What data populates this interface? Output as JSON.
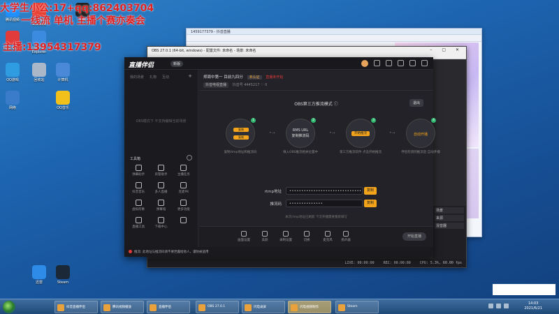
{
  "overlay": {
    "line1": "大学生小公:17+qq:862403704",
    "line2": "一线流 单机 主播个赛亦奏会",
    "line3": "主播:13954317379"
  },
  "desktop_icons": [
    {
      "label": "腾讯视频",
      "color": "#1f8fff"
    },
    {
      "label": "Google Chrome",
      "color": "#e94235"
    },
    {
      "label": "WPS Office",
      "color": "#e23b3b"
    },
    {
      "label": "QQ游戏",
      "color": "#2f9be0"
    },
    {
      "label": "回收站",
      "color": "#aab7c9"
    },
    {
      "label": "计算机",
      "color": "#4a89d8"
    },
    {
      "label": "Internet Explorer",
      "color": "#3b8be0"
    },
    {
      "label": "剪映",
      "color": "#222"
    },
    {
      "label": "网络",
      "color": "#3a7cc9"
    },
    {
      "label": "QQ音乐",
      "color": "#f2c01b"
    },
    {
      "label": "Steam",
      "color": "#1b2838"
    },
    {
      "label": "迅雷",
      "color": "#2e8ce8"
    }
  ],
  "browser": {
    "title": "1459177379 - 抖音直播"
  },
  "obs": {
    "title": "OBS 27.0.1 (64-bit, windows) - 配置文件: 未命名 - 场景: 未命名",
    "side_items": [
      "场景",
      "来源",
      "混音器"
    ],
    "status": {
      "live": "LIVE: 00:00:00",
      "rec": "REC: 00:00:00",
      "cpu": "CPU: 5.3%, 60.00 fps"
    }
  },
  "app": {
    "logo": "直播伴侣",
    "badge": "新版",
    "left_tabs": [
      "我的场景",
      "礼物",
      "互动"
    ],
    "left_empty": "OBS模式下 不支持编辑当前场景",
    "tools_title": "工具箱",
    "tools": [
      "弹幕助手",
      "房管助手",
      "主播任务",
      "抖音音乐",
      "多人直播",
      "连麦PK",
      "虚拟形象",
      "弹幕墙",
      "更多功能",
      "直播工具",
      "下载中心",
      ""
    ],
    "room": {
      "title": "郑周中第一 目前九四分",
      "tag": "未认证",
      "live_state": "直播未开始",
      "room_pill": "抖音电视直播",
      "number": "抖音号 4445217",
      "likes": "0"
    },
    "mode_title": "OBS第三方推流模式",
    "exit_label": "退出",
    "steps": [
      {
        "num": "1",
        "btn1": "复制",
        "btn2": "复制",
        "desc": "复制rtmp地址和推流码"
      },
      {
        "num": "2",
        "line1": "RMS URL",
        "line2": "复制推流码",
        "desc": "填入OBS推流相关位置中"
      },
      {
        "num": "3",
        "btn": "开始推流",
        "desc": "第三方推流软件 点击开始推流"
      },
      {
        "num": "4",
        "line": "自动开播",
        "desc": "伴侣检测到推流后 自动开播"
      }
    ],
    "rtmp_label": "rtmp地址",
    "rtmp_value": "••••••••••••••••••••••••••••••••••••",
    "key_label": "推流码",
    "key_value": "••••••••••••••",
    "copy_label": "复制",
    "hint": "本次rtmp地址已刷新 下次开播需要重新填写",
    "bottom_buttons": [
      "画面设置",
      "美颜",
      "录制设置",
      "切换",
      "麦克风",
      "扬声器"
    ],
    "go_live": "开始直播",
    "footer": "推流: 此地址与推流码请不要泄露给他人，谨防被盗用"
  },
  "taskbar": {
    "items": [
      "抖音直播伴侣",
      "腾讯视频播放",
      "直播伴侣",
      "OBS 27.0.1",
      "闪电录屏",
      "闪电视频制作",
      "Steam"
    ],
    "active_index": 5,
    "time": "14:03",
    "date": "2021/6/21"
  }
}
